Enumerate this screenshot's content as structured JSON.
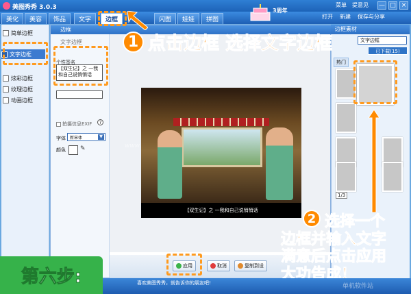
{
  "window": {
    "title": "美图秀秀 3.0.3",
    "top_links": [
      "菜单",
      "提意见"
    ],
    "controls": [
      "—",
      "□",
      "×"
    ]
  },
  "nav": {
    "tabs": [
      {
        "label": "美化"
      },
      {
        "label": "美容"
      },
      {
        "label": "饰品"
      },
      {
        "label": "文字"
      },
      {
        "label": "边框"
      },
      {
        "label": "闪图"
      },
      {
        "label": "娃娃"
      },
      {
        "label": "拼图"
      }
    ],
    "right_buttons": [
      "打开",
      "新建",
      "保存与分享"
    ],
    "anniversary": "3周年"
  },
  "left_panel": {
    "items": [
      {
        "label": "简单边框"
      },
      {
        "label": "文字边框"
      },
      {
        "label": "炫彩边框"
      },
      {
        "label": "纹理边框"
      },
      {
        "label": "动画边框"
      }
    ]
  },
  "editor": {
    "title": "边框",
    "sign_header": "文字边框",
    "sign_label": "个性签名",
    "sign_value": "【双生记】之 一我和自己说悄悄话",
    "exif_label": "拍摄信息EXIF",
    "font_label": "字体",
    "font_value": "新宋体",
    "color_label": "颜色",
    "caption": "【双生记】之 一我和自己说悄悄话",
    "watermark": "www."
  },
  "buttons": {
    "apply": "应用",
    "cancel": "取消",
    "reset": "复制到设"
  },
  "right_panel": {
    "title": "边框素材",
    "select_value": "文字边框",
    "download_label": "已下载(15)",
    "tabs": [
      "热门"
    ],
    "pager": "1/3"
  },
  "status": {
    "text": "喜欢美图秀秀，就告诉你的朋友吧!",
    "watermark": "单机软件站"
  },
  "annotations": {
    "step1_num": "1",
    "step1_text": "点击边框 选择文字边框",
    "step2_num": "2",
    "step2_line1": "选择一个",
    "step2_line2": "边框并输入文字",
    "step2_line3": "满意后点击应用",
    "step2_line4": "大功告成！",
    "step6": "第六步:"
  },
  "colors": {
    "accent": "#ff8a00",
    "primary_blue": "#2d6fc4",
    "step_green": "#36b24a"
  }
}
